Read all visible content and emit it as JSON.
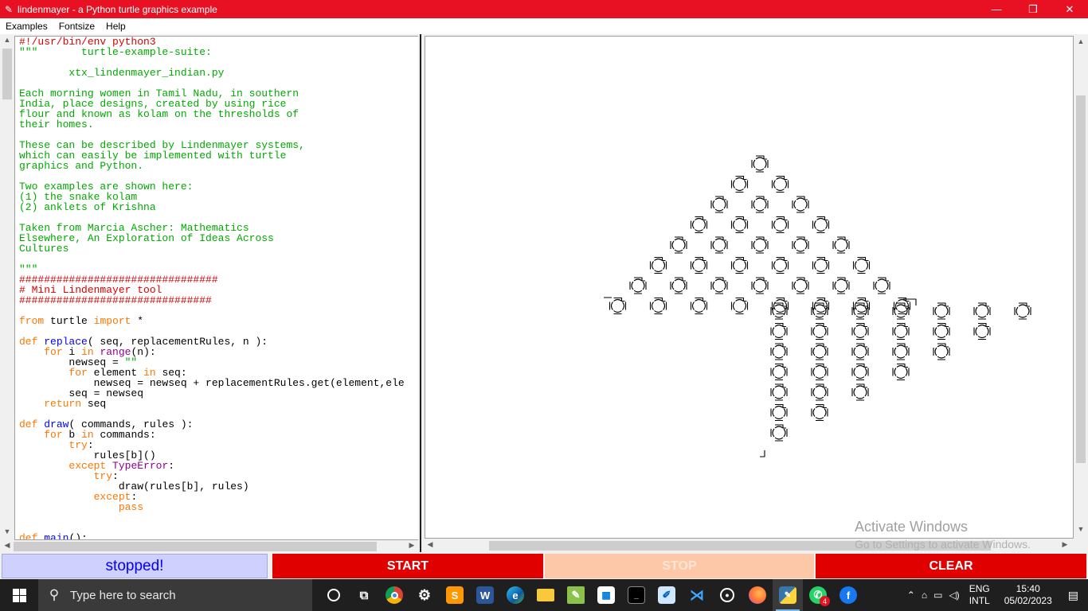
{
  "window": {
    "title": "lindenmayer - a Python turtle graphics example",
    "icon": "feather-icon",
    "minimize_glyph": "—",
    "maximize_glyph": "❐",
    "close_glyph": "✕"
  },
  "menu": {
    "items": [
      "Examples",
      "Fontsize",
      "Help"
    ]
  },
  "code": {
    "lines": [
      [
        {
          "t": "#!/usr/bin/env python3",
          "c": "com"
        }
      ],
      [
        {
          "t": "\"\"\"       turtle-example-suite:",
          "c": "str"
        }
      ],
      [
        {
          "t": "",
          "c": "str"
        }
      ],
      [
        {
          "t": "        xtx_lindenmayer_indian.py",
          "c": "str"
        }
      ],
      [
        {
          "t": "",
          "c": "str"
        }
      ],
      [
        {
          "t": "Each morning women in Tamil Nadu, in southern",
          "c": "str"
        }
      ],
      [
        {
          "t": "India, place designs, created by using rice",
          "c": "str"
        }
      ],
      [
        {
          "t": "flour and known as kolam on the thresholds of",
          "c": "str"
        }
      ],
      [
        {
          "t": "their homes.",
          "c": "str"
        }
      ],
      [
        {
          "t": "",
          "c": "str"
        }
      ],
      [
        {
          "t": "These can be described by Lindenmayer systems,",
          "c": "str"
        }
      ],
      [
        {
          "t": "which can easily be implemented with turtle",
          "c": "str"
        }
      ],
      [
        {
          "t": "graphics and Python.",
          "c": "str"
        }
      ],
      [
        {
          "t": "",
          "c": "str"
        }
      ],
      [
        {
          "t": "Two examples are shown here:",
          "c": "str"
        }
      ],
      [
        {
          "t": "(1) the snake kolam",
          "c": "str"
        }
      ],
      [
        {
          "t": "(2) anklets of Krishna",
          "c": "str"
        }
      ],
      [
        {
          "t": "",
          "c": "str"
        }
      ],
      [
        {
          "t": "Taken from Marcia Ascher: Mathematics",
          "c": "str"
        }
      ],
      [
        {
          "t": "Elsewhere, An Exploration of Ideas Across",
          "c": "str"
        }
      ],
      [
        {
          "t": "Cultures",
          "c": "str"
        }
      ],
      [
        {
          "t": "",
          "c": "str"
        }
      ],
      [
        {
          "t": "\"\"\"",
          "c": "str"
        }
      ],
      [
        {
          "t": "################################",
          "c": "com"
        }
      ],
      [
        {
          "t": "# Mini Lindenmayer tool",
          "c": "com"
        }
      ],
      [
        {
          "t": "###############################",
          "c": "com"
        }
      ],
      [
        {
          "t": "",
          "c": "plain"
        }
      ],
      [
        {
          "t": "from",
          "c": "kw"
        },
        {
          "t": " turtle ",
          "c": "plain"
        },
        {
          "t": "import",
          "c": "kw"
        },
        {
          "t": " *",
          "c": "plain"
        }
      ],
      [
        {
          "t": "",
          "c": "plain"
        }
      ],
      [
        {
          "t": "def",
          "c": "kw"
        },
        {
          "t": " ",
          "c": "plain"
        },
        {
          "t": "replace",
          "c": "def"
        },
        {
          "t": "( seq, replacementRules, n ):",
          "c": "plain"
        }
      ],
      [
        {
          "t": "    ",
          "c": "plain"
        },
        {
          "t": "for",
          "c": "kw"
        },
        {
          "t": " i ",
          "c": "plain"
        },
        {
          "t": "in",
          "c": "kw"
        },
        {
          "t": " ",
          "c": "plain"
        },
        {
          "t": "range",
          "c": "bi"
        },
        {
          "t": "(n):",
          "c": "plain"
        }
      ],
      [
        {
          "t": "        newseq = ",
          "c": "plain"
        },
        {
          "t": "\"\"",
          "c": "str"
        }
      ],
      [
        {
          "t": "        ",
          "c": "plain"
        },
        {
          "t": "for",
          "c": "kw"
        },
        {
          "t": " element ",
          "c": "plain"
        },
        {
          "t": "in",
          "c": "kw"
        },
        {
          "t": " seq:",
          "c": "plain"
        }
      ],
      [
        {
          "t": "            newseq = newseq + replacementRules.get(element,ele",
          "c": "plain"
        }
      ],
      [
        {
          "t": "        seq = newseq",
          "c": "plain"
        }
      ],
      [
        {
          "t": "    ",
          "c": "plain"
        },
        {
          "t": "return",
          "c": "kw"
        },
        {
          "t": " seq",
          "c": "plain"
        }
      ],
      [
        {
          "t": "",
          "c": "plain"
        }
      ],
      [
        {
          "t": "def",
          "c": "kw"
        },
        {
          "t": " ",
          "c": "plain"
        },
        {
          "t": "draw",
          "c": "def"
        },
        {
          "t": "( commands, rules ):",
          "c": "plain"
        }
      ],
      [
        {
          "t": "    ",
          "c": "plain"
        },
        {
          "t": "for",
          "c": "kw"
        },
        {
          "t": " b ",
          "c": "plain"
        },
        {
          "t": "in",
          "c": "kw"
        },
        {
          "t": " commands:",
          "c": "plain"
        }
      ],
      [
        {
          "t": "        ",
          "c": "plain"
        },
        {
          "t": "try",
          "c": "kw"
        },
        {
          "t": ":",
          "c": "plain"
        }
      ],
      [
        {
          "t": "            rules[b]()",
          "c": "plain"
        }
      ],
      [
        {
          "t": "        ",
          "c": "plain"
        },
        {
          "t": "except",
          "c": "kw"
        },
        {
          "t": " ",
          "c": "plain"
        },
        {
          "t": "TypeError",
          "c": "bi"
        },
        {
          "t": ":",
          "c": "plain"
        }
      ],
      [
        {
          "t": "            ",
          "c": "plain"
        },
        {
          "t": "try",
          "c": "kw"
        },
        {
          "t": ":",
          "c": "plain"
        }
      ],
      [
        {
          "t": "                draw(rules[b], rules)",
          "c": "plain"
        }
      ],
      [
        {
          "t": "            ",
          "c": "plain"
        },
        {
          "t": "except",
          "c": "kw"
        },
        {
          "t": ":",
          "c": "plain"
        }
      ],
      [
        {
          "t": "                ",
          "c": "plain"
        },
        {
          "t": "pass",
          "c": "kw"
        }
      ],
      [
        {
          "t": "",
          "c": "plain"
        }
      ],
      [
        {
          "t": "",
          "c": "plain"
        }
      ],
      [
        {
          "t": "def",
          "c": "kw"
        },
        {
          "t": " ",
          "c": "plain"
        },
        {
          "t": "main",
          "c": "def"
        },
        {
          "t": "():",
          "c": "plain"
        }
      ]
    ]
  },
  "colors": {
    "titlebar": "#e81123",
    "string": "#00aa00",
    "comment": "#dd0000",
    "keyword": "#ff7700",
    "defname": "#0000ff",
    "builtin": "#900090",
    "button_red": "#e00000",
    "button_stop_disabled": "#fdc8a8",
    "status_bg": "#d0d0ff",
    "status_fg": "#0000ff"
  },
  "controls": {
    "status": "stopped!",
    "start": "START",
    "stop": "STOP",
    "clear": "CLEAR"
  },
  "watermark": {
    "line1": "Activate Windows",
    "line2": "Go to Settings to activate Windows."
  },
  "taskbar": {
    "search_placeholder": "Type here to search",
    "icons": [
      "task-view-icon",
      "taskview-icon",
      "chrome-icon",
      "settings-icon",
      "sublime-icon",
      "word-icon",
      "edge-icon",
      "file-explorer-icon",
      "notepad-icon",
      "store-icon",
      "terminal-icon",
      "paint-icon",
      "vscode-icon",
      "obs-icon",
      "firefox-icon",
      "python-icon",
      "whatsapp-icon",
      "facebook-icon"
    ],
    "whatsapp_badge": "4",
    "lang_line1": "ENG",
    "lang_line2": "INTL",
    "time": "15:40",
    "date": "05/02/2023"
  }
}
